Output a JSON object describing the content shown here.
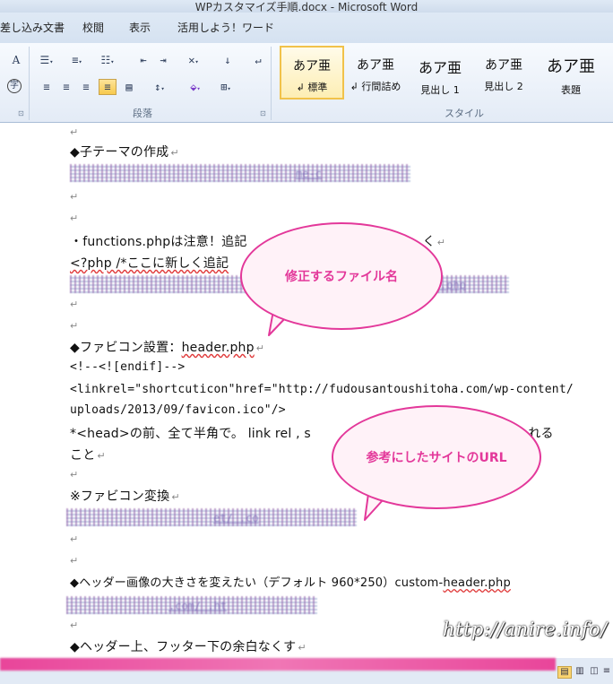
{
  "window": {
    "title": "WPカスタマイズ手順.docx - Microsoft Word"
  },
  "ribbon": {
    "tabs": [
      "差し込み文書",
      "校閲",
      "表示",
      "活用しよう！ワード"
    ],
    "groups": {
      "paragraph": "段落",
      "styles": "スタイル"
    },
    "styles": [
      {
        "sample": "あア亜",
        "name": "↲ 標準",
        "selected": true
      },
      {
        "sample": "あア亜",
        "name": "↲ 行間詰め",
        "selected": false
      },
      {
        "sample": "あア亜",
        "name": "見出し 1",
        "selected": false
      },
      {
        "sample": "あア亜",
        "name": "見出し 2",
        "selected": false
      },
      {
        "sample": "あア亜",
        "name": "表題",
        "selected": false
      }
    ],
    "icons": {
      "font_a": "A",
      "phonetic": "字",
      "bullets": "bullet-list-icon",
      "numbering": "numbered-list-icon",
      "multilevel": "multilevel-list-icon",
      "decrease_indent": "decrease-indent-icon",
      "increase_indent": "increase-indent-icon",
      "asian_layout": "asian-layout-icon",
      "sort": "sort-icon",
      "show_marks": "paragraph-mark-icon"
    }
  },
  "document": {
    "paragraph_mark": "↵",
    "lines": {
      "child_theme": "◆子テーマの作成",
      "child_theme_url_frag": "me-c  ",
      "functions_note": "・functions.phpは注意！追記",
      "functions_note_end": "く",
      "php_comment": "<?php /*ここに新しく追記",
      "php_url_frag": "ior  .php",
      "favicon_title": "◆ファビコン設置：",
      "favicon_title_file": "header.php",
      "ie_comment": "<!--<![endif]-->",
      "link_tag_1": "<linkrel=\"shortcuticon\"href=\"http://fudousantoushitoha.com/wp-content/",
      "link_tag_2": "uploads/2013/09/favicon.ico\"/>",
      "head_note": "*<head>の前、全て半角で。 link rel , s",
      "head_note_end": "ス入れる",
      "head_note_cont": "こと",
      "favicon_convert": "※ファビコン変換",
      "favicon_url_frag": "et/   .co",
      "header_size": "◆ヘッダー画像の大きさを変えたい（デフォルト 960*250）custom-",
      "header_size_file": "header.php",
      "header_url_frag": "  .com/  .ht",
      "margins": "◆ヘッダー上、フッター下の余白なくす"
    }
  },
  "callouts": {
    "file_name": "修正するファイル名",
    "reference": "参考にしたサイトのURL"
  },
  "watermark": "http://anire.info/",
  "colors": {
    "callout": "#e3389a",
    "callout_fill": "#fff2f8"
  }
}
